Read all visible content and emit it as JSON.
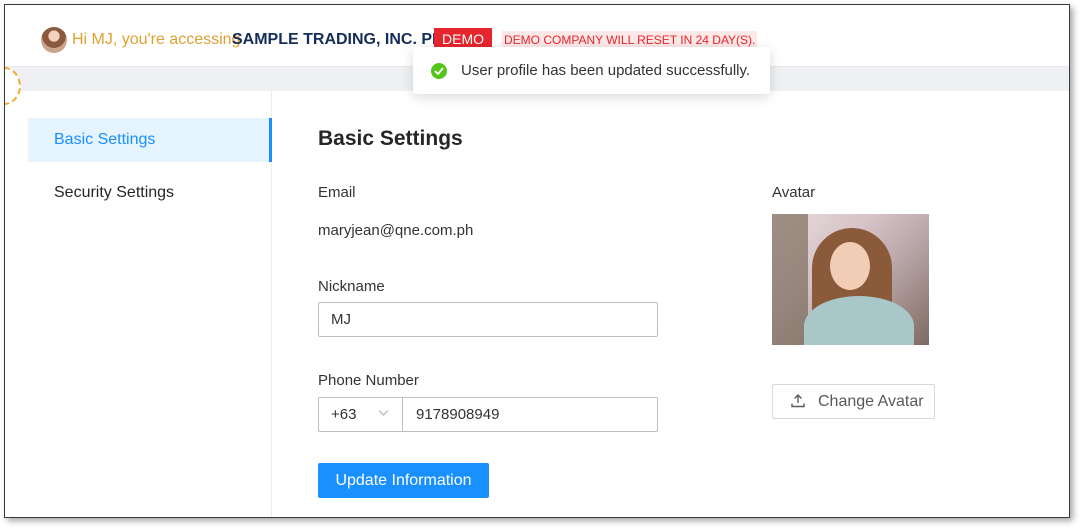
{
  "header": {
    "greeting": "Hi MJ, you're accessing",
    "company": "SAMPLE TRADING, INC. PH",
    "demo_badge": "DEMO",
    "reset_notice": "DEMO COMPANY WILL RESET IN 24 DAY(S)."
  },
  "toast": {
    "message": "User profile has been updated successfully.",
    "icon": "check-circle-icon",
    "color": "#52c41a"
  },
  "sidebar": {
    "items": [
      {
        "label": "Basic Settings",
        "active": true
      },
      {
        "label": "Security Settings",
        "active": false
      }
    ]
  },
  "main": {
    "title": "Basic Settings",
    "email_label": "Email",
    "email_value": "maryjean@qne.com.ph",
    "nickname_label": "Nickname",
    "nickname_value": "MJ",
    "phone_label": "Phone Number",
    "phone_code": "+63",
    "phone_value": "9178908949",
    "update_label": "Update Information",
    "avatar_label": "Avatar",
    "change_avatar_label": "Change Avatar"
  },
  "colors": {
    "primary": "#1890ff",
    "accent": "#e0a030",
    "brand_navy": "#152d58",
    "danger": "#e6262c",
    "success": "#52c41a"
  }
}
